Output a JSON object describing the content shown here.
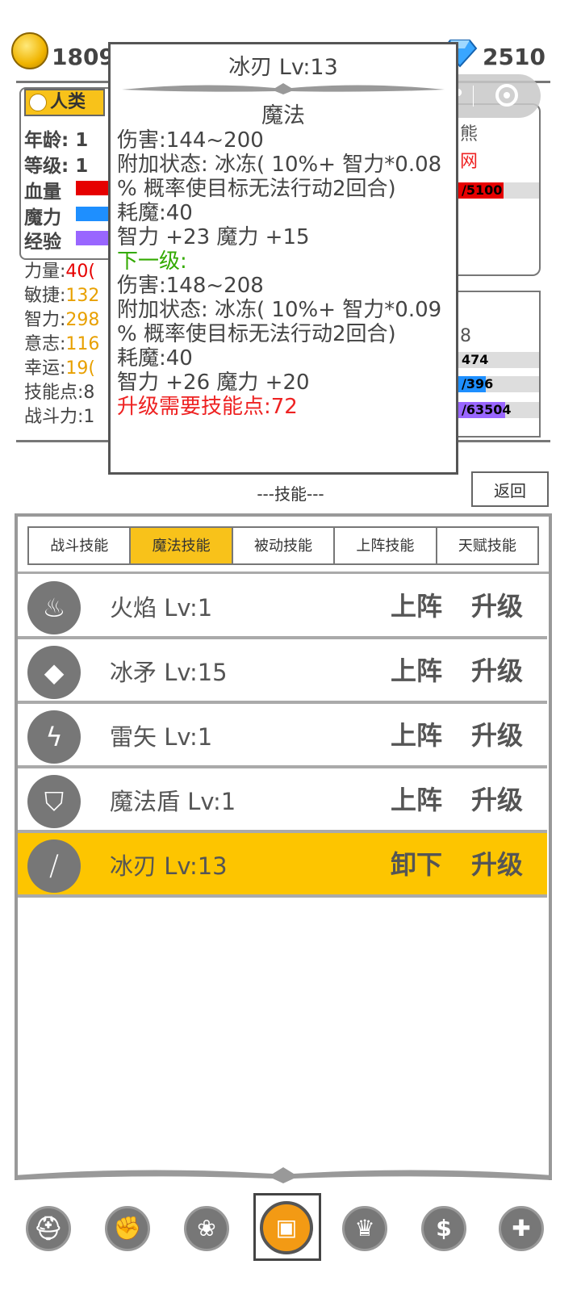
{
  "currency": {
    "gold": "1809",
    "gems": "2510"
  },
  "character": {
    "race": "人类",
    "labels": {
      "age": "年龄: 1",
      "level": "等级: 1",
      "hp": "血量",
      "mp": "魔力",
      "exp": "经验"
    },
    "attributes": [
      {
        "label": "力量:",
        "value": "40("
      },
      {
        "label": "敏捷:",
        "value": "132"
      },
      {
        "label": "智力:",
        "value": "298"
      },
      {
        "label": "意志:",
        "value": "116"
      },
      {
        "label": "幸运:",
        "value": "19("
      },
      {
        "label": "技能点:",
        "value": "8"
      },
      {
        "label": "战斗力:",
        "value": "1"
      }
    ],
    "right_fragments": {
      "t1": "熊",
      "t2": "网",
      "hp_bar": "/5100",
      "t3": "8",
      "bar2": "474",
      "bar3": "/396",
      "bar4": "/63504"
    }
  },
  "tooltip": {
    "title": "冰刃 Lv:13",
    "type": "魔法",
    "lines": [
      {
        "text": "伤害:144~200",
        "style": "normal"
      },
      {
        "text": "附加状态: 冰冻( 10%+ 智力*0.08",
        "style": "normal"
      },
      {
        "text": "% 概率使目标无法行动2回合)",
        "style": "normal"
      },
      {
        "text": "耗魔:40",
        "style": "normal"
      },
      {
        "text": "智力 +23 魔力 +15",
        "style": "normal"
      },
      {
        "text": "下一级:",
        "style": "green"
      },
      {
        "text": "伤害:148~208",
        "style": "normal"
      },
      {
        "text": "附加状态: 冰冻( 10%+ 智力*0.09",
        "style": "normal"
      },
      {
        "text": "% 概率使目标无法行动2回合)",
        "style": "normal"
      },
      {
        "text": "耗魔:40",
        "style": "normal"
      },
      {
        "text": "智力 +26 魔力 +20",
        "style": "normal"
      },
      {
        "text": "升级需要技能点:72",
        "style": "red"
      }
    ]
  },
  "section": {
    "title": "---技能---",
    "return_label": "返回"
  },
  "tabs": [
    {
      "label": "战斗技能",
      "active": false
    },
    {
      "label": "魔法技能",
      "active": true
    },
    {
      "label": "被动技能",
      "active": false
    },
    {
      "label": "上阵技能",
      "active": false
    },
    {
      "label": "天赋技能",
      "active": false
    }
  ],
  "skills": [
    {
      "name": "火焰 Lv:1",
      "equip": "上阵",
      "upgrade": "升级",
      "icon": "flame-icon",
      "selected": false
    },
    {
      "name": "冰矛 Lv:15",
      "equip": "上阵",
      "upgrade": "升级",
      "icon": "ice-spear-icon",
      "selected": false
    },
    {
      "name": "雷矢 Lv:1",
      "equip": "上阵",
      "upgrade": "升级",
      "icon": "lightning-icon",
      "selected": false
    },
    {
      "name": "魔法盾 Lv:1",
      "equip": "上阵",
      "upgrade": "升级",
      "icon": "shield-icon",
      "selected": false
    },
    {
      "name": "冰刃 Lv:13",
      "equip": "卸下",
      "upgrade": "升级",
      "icon": "ice-blade-icon",
      "selected": true
    }
  ],
  "nav": [
    {
      "icon": "helmet-icon",
      "selected": false
    },
    {
      "icon": "fist-icon",
      "selected": false
    },
    {
      "icon": "paw-icon",
      "selected": false
    },
    {
      "icon": "spellbook-icon",
      "selected": true
    },
    {
      "icon": "crown-icon",
      "selected": false
    },
    {
      "icon": "money-bag-icon",
      "selected": false
    },
    {
      "icon": "plus-icon",
      "selected": false
    }
  ],
  "colors": {
    "accent": "#fdc500",
    "tooltip_next": "#33aa00",
    "tooltip_cost": "#ee2222"
  }
}
